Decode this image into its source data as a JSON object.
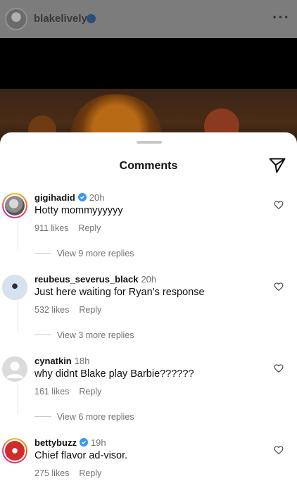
{
  "post": {
    "username": "blakelively",
    "more_icon": "more-icon"
  },
  "sheet": {
    "title": "Comments",
    "share_icon": "share-icon"
  },
  "comments": [
    {
      "username": "gigihadid",
      "verified": true,
      "time": "20h",
      "text": "Hotty mommyyyyyy",
      "likes": "911 likes",
      "reply": "Reply",
      "view_replies": "View 9 more replies"
    },
    {
      "username": "reubeus_severus_black",
      "verified": false,
      "time": "20h",
      "text": "Just here waiting for Ryan’s response",
      "likes": "532 likes",
      "reply": "Reply",
      "view_replies": "View 3 more replies"
    },
    {
      "username": "cynatkin",
      "verified": false,
      "time": "18h",
      "text": "why didnt Blake play Barbie??????",
      "likes": "161 likes",
      "reply": "Reply",
      "view_replies": "View 6 more replies"
    },
    {
      "username": "bettybuzz",
      "verified": true,
      "time": "19h",
      "text": "Chief flavor ad-visor.",
      "likes": "275 likes",
      "reply": "Reply"
    }
  ]
}
